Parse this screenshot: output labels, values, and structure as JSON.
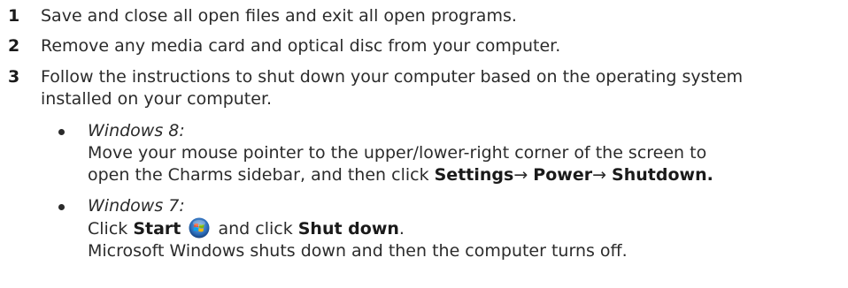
{
  "steps": [
    {
      "number": "1",
      "text": "Save and close all open files and exit all open programs."
    },
    {
      "number": "2",
      "text": "Remove any media card and optical disc from your computer."
    },
    {
      "number": "3",
      "text_line1": "Follow the instructions to shut down your computer based on the operating system",
      "text_line2": "installed on your computer."
    }
  ],
  "bullets": {
    "win8": {
      "os_label": "Windows 8:",
      "line1": "Move your mouse pointer to the upper/lower-right corner of the screen to",
      "line2_prefix": "open the Charms sidebar, and then click ",
      "settings": "Settings",
      "arrow1": "→",
      "power": "Power",
      "arrow2": "→",
      "shutdown": "Shutdown."
    },
    "win7": {
      "os_label": "Windows 7:",
      "click1": "Click ",
      "start": "Start",
      "icon": "windows-start-icon",
      "and_click": " and click ",
      "shut_down": "Shut down",
      "period": ".",
      "line3": "Microsoft Windows shuts down and then the computer turns off."
    }
  }
}
